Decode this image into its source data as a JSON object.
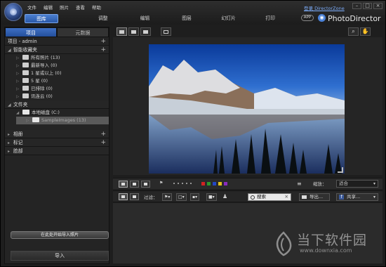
{
  "menu": [
    "文件",
    "编辑",
    "照片",
    "查看",
    "帮助"
  ],
  "account": {
    "signin": "登录 DirectorZone"
  },
  "brand": {
    "app_badge": "APP",
    "name": "PhotoDirector"
  },
  "main_tabs": [
    "图库",
    "调整",
    "编辑",
    "图层",
    "幻灯片",
    "打印"
  ],
  "left_tabs": [
    "项目",
    "元数据"
  ],
  "project": {
    "label": "项目 - admin"
  },
  "smart_collections": {
    "label": "智能收藏夹",
    "items": [
      "所有照片 (13)",
      "最新导入 (0)",
      "1 星或以上 (0)",
      "5 星 (0)",
      "已排除 (0)",
      "讯连云 (0)"
    ]
  },
  "folders": {
    "label": "文件夹",
    "drive": "本地磁盘 (C:)",
    "folder": "SampleImages (13)"
  },
  "albums": {
    "label": "相册"
  },
  "tags": {
    "label": "标记"
  },
  "faces": {
    "label": "脸部"
  },
  "import_hint": "在此处开始导入照片",
  "import_button": "导入",
  "colors": {
    "accent": "#2f63b8",
    "labels": [
      "#d32222",
      "#2a9a2a",
      "#2347c4",
      "#e2c21a",
      "#8a2bbf"
    ]
  },
  "viewer_toolbar": {
    "zoom_label": "缩放：",
    "zoom_value": "适合"
  },
  "filmstrip_toolbar": {
    "filter_label": "过滤：",
    "search_label": "搜索",
    "export_label": "导出...",
    "share_label": "共享..."
  },
  "watermark": {
    "text": "当下软件园",
    "url": "www.downxia.com"
  }
}
